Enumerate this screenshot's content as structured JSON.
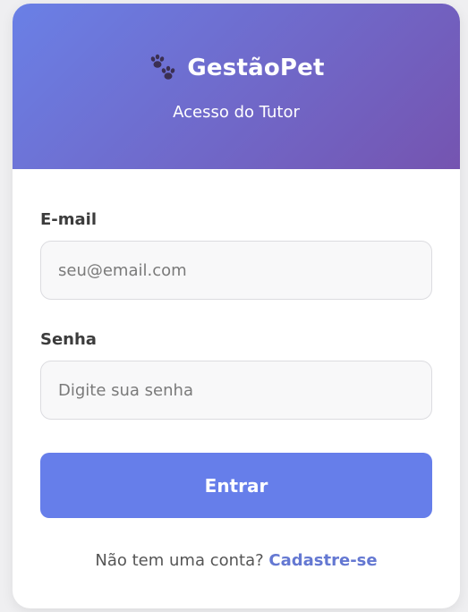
{
  "header": {
    "icon": "paw-prints-icon",
    "brand": "GestãoPet",
    "subtitle": "Acesso do Tutor"
  },
  "form": {
    "email_label": "E-mail",
    "email_placeholder": "seu@email.com",
    "password_label": "Senha",
    "password_placeholder": "Digite sua senha",
    "submit_label": "Entrar"
  },
  "footer": {
    "prompt": "Não tem uma conta?",
    "signup_link": "Cadastre-se"
  },
  "colors": {
    "header_gradient_start": "#6a80e6",
    "header_gradient_end": "#7554b0",
    "button": "#667eea",
    "link": "#6478d2"
  }
}
